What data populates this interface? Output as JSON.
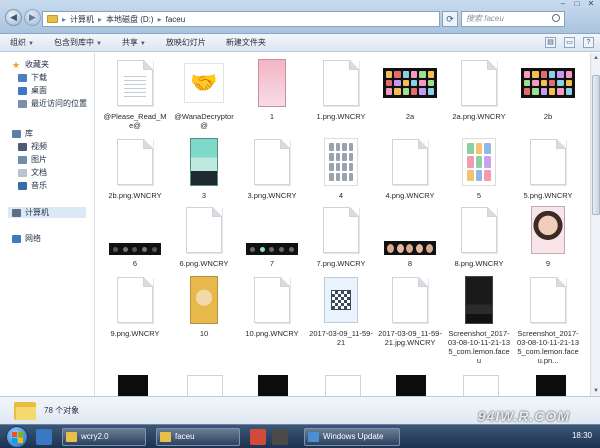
{
  "address": {
    "parts": [
      "计算机",
      "本地磁盘 (D:)",
      "faceu"
    ],
    "search_placeholder": "搜索 faceu"
  },
  "toolbar": {
    "organize": "组织",
    "include_in_library": "包含到库中",
    "share": "共享",
    "slideshow": "放映幻灯片",
    "new_folder": "新建文件夹"
  },
  "sidebar": {
    "favorites": "收藏夹",
    "downloads": "下载",
    "desktop": "桌面",
    "recent": "最近访问的位置",
    "libraries": "库",
    "videos": "视频",
    "pictures": "图片",
    "documents": "文档",
    "music": "音乐",
    "computer": "计算机",
    "network": "网络"
  },
  "files": [
    {
      "name": "@Please_Read_Me@",
      "kind": "doc-lines"
    },
    {
      "name": "@WanaDecryptor@",
      "kind": "handshake"
    },
    {
      "name": "1",
      "kind": "photo-pink"
    },
    {
      "name": "1.png.WNCRY",
      "kind": "doc"
    },
    {
      "name": "2a",
      "kind": "grid-dark"
    },
    {
      "name": "2a.png.WNCRY",
      "kind": "doc"
    },
    {
      "name": "2b",
      "kind": "grid-dark"
    },
    {
      "name": "2b.png.WNCRY",
      "kind": "doc"
    },
    {
      "name": "3",
      "kind": "phone-teal"
    },
    {
      "name": "3.png.WNCRY",
      "kind": "doc"
    },
    {
      "name": "4",
      "kind": "grid-white"
    },
    {
      "name": "4.png.WNCRY",
      "kind": "doc"
    },
    {
      "name": "5",
      "kind": "phone-white"
    },
    {
      "name": "5.png.WNCRY",
      "kind": "doc"
    },
    {
      "name": "6",
      "kind": "strip"
    },
    {
      "name": "6.png.WNCRY",
      "kind": "doc"
    },
    {
      "name": "7",
      "kind": "strip-dots"
    },
    {
      "name": "7.png.WNCRY",
      "kind": "doc"
    },
    {
      "name": "8",
      "kind": "strip-faces"
    },
    {
      "name": "8.png.WNCRY",
      "kind": "doc"
    },
    {
      "name": "9",
      "kind": "photo-woman"
    },
    {
      "name": "9.png.WNCRY",
      "kind": "doc"
    },
    {
      "name": "10",
      "kind": "photo-yellow"
    },
    {
      "name": "10.png.WNCRY",
      "kind": "doc"
    },
    {
      "name": "2017-03-09_11-59-21",
      "kind": "qr"
    },
    {
      "name": "2017-03-09_11-59-21.jpg.WNCRY",
      "kind": "doc"
    },
    {
      "name": "Screenshot_2017-03-08-10-11-21-135_com.lemon.faceu",
      "kind": "phone-dark"
    },
    {
      "name": "Screenshot_2017-03-08-10-11-21-135_com.lemon.faceu.pn...",
      "kind": "doc"
    }
  ],
  "status": {
    "count_text": "78 个对象"
  },
  "taskbar": {
    "task1": "wcry2.0",
    "task2": "faceu",
    "task3": "Windows Update",
    "clock": "18:30"
  },
  "watermark": "94IW.R.COM",
  "colors": {
    "accent": "#a9c3de",
    "taskbar": "#1d3250",
    "folder": "#e9bd3e"
  }
}
